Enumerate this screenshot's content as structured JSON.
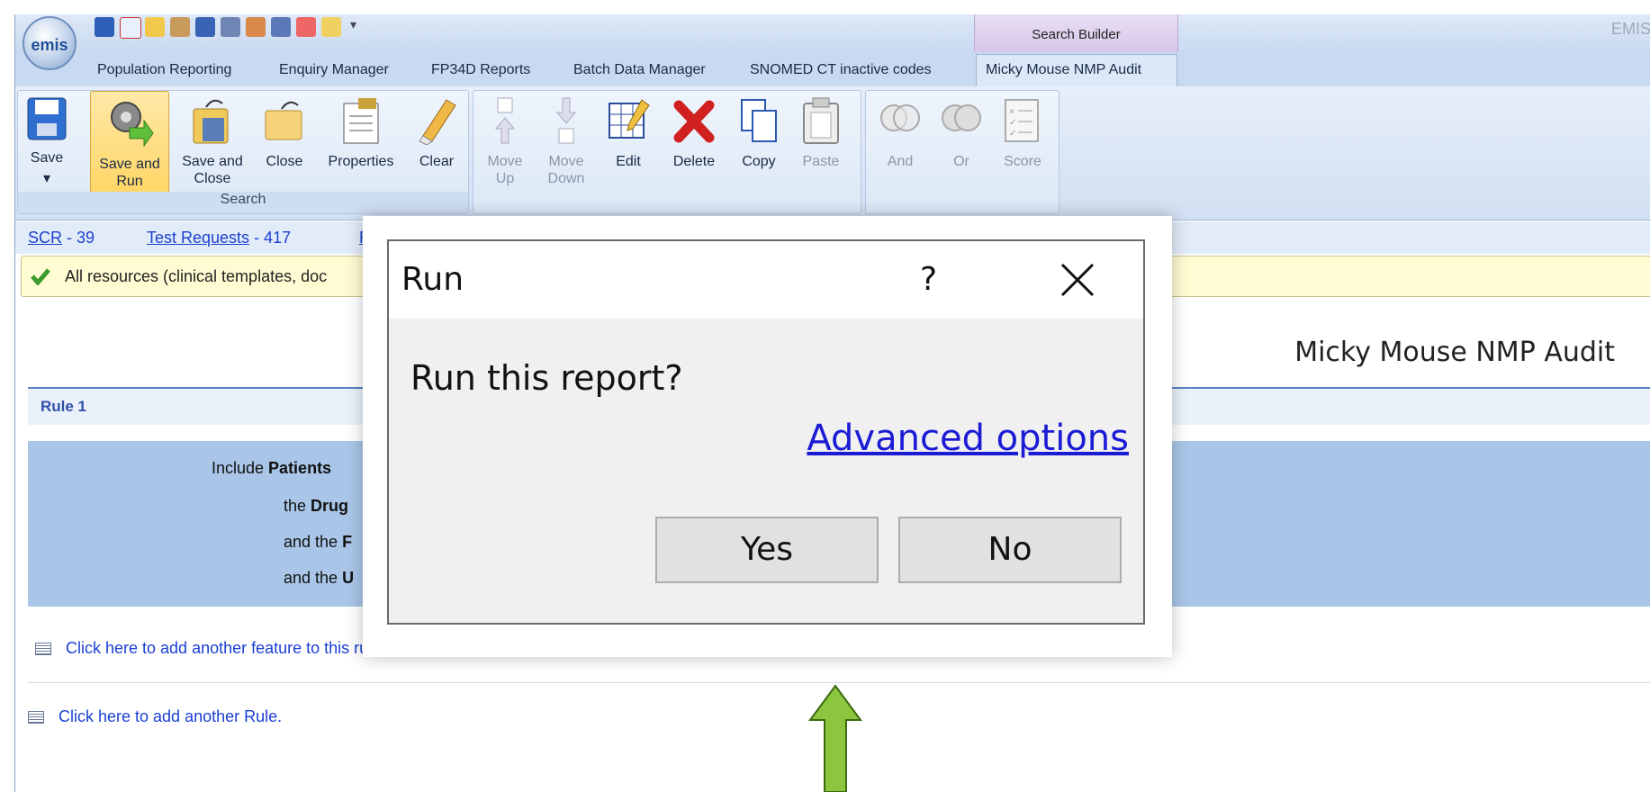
{
  "quick_access": {
    "context_tab": "Search Builder",
    "brand": "EMIS",
    "logo": "emis",
    "icons": [
      "back-icon",
      "home-icon",
      "pencil-icon",
      "users-icon",
      "notes-icon",
      "calendar-icon",
      "people-icon",
      "document-icon",
      "pen-icon",
      "mail-icon"
    ]
  },
  "tabs": [
    {
      "label": "Population Reporting"
    },
    {
      "label": "Enquiry Manager"
    },
    {
      "label": "FP34D Reports"
    },
    {
      "label": "Batch Data Manager"
    },
    {
      "label": "SNOMED CT inactive codes"
    },
    {
      "label": "Micky Mouse NMP Audit",
      "active": true
    }
  ],
  "ribbon": {
    "search_group": {
      "label": "Search",
      "buttons": [
        {
          "label": "Save",
          "icon": "floppy-icon"
        },
        {
          "label": "Save and Run",
          "icon": "gear-run-icon"
        },
        {
          "label": "Save and Close",
          "icon": "save-close-icon"
        },
        {
          "label": "Close",
          "icon": "folder-close-icon"
        },
        {
          "label": "Properties",
          "icon": "properties-icon"
        },
        {
          "label": "Clear",
          "icon": "eraser-icon"
        }
      ]
    },
    "edit_group": {
      "buttons": [
        {
          "label": "Move Up",
          "icon": "move-up-icon"
        },
        {
          "label": "Move Down",
          "icon": "move-down-icon"
        },
        {
          "label": "Edit",
          "icon": "edit-icon"
        },
        {
          "label": "Delete",
          "icon": "delete-icon"
        },
        {
          "label": "Copy",
          "icon": "copy-icon"
        },
        {
          "label": "Paste",
          "icon": "paste-icon"
        }
      ]
    },
    "logic_group": {
      "buttons": [
        {
          "label": "And",
          "icon": "and-icon"
        },
        {
          "label": "Or",
          "icon": "or-icon"
        },
        {
          "label": "Score",
          "icon": "score-icon"
        }
      ]
    }
  },
  "links_bar": {
    "scr_label": "SCR",
    "scr_count": " - 39",
    "test_label": "Test Requests",
    "test_count": " - 417",
    "third": "F"
  },
  "banner": {
    "text": "All resources (clinical templates, doc"
  },
  "content": {
    "report_title": "Micky Mouse NMP Audit",
    "rule_title": "Rule 1",
    "rule_lines": {
      "l1_pre": "Include ",
      "l1_bold": "Patients",
      "l2_pre": "the ",
      "l2_bold": "Drug",
      "l3_pre": "and the ",
      "l3_bold": "F",
      "l4_pre": "and the ",
      "l4_bold": "U"
    },
    "add_feature": "Click here to add another feature to this rule.",
    "add_rule": "Click here to add another Rule."
  },
  "dialog": {
    "title": "Run",
    "help": "?",
    "message": "Run this report?",
    "advanced": "Advanced options",
    "yes": "Yes",
    "no": "No"
  },
  "colors": {
    "ribbon": "#d2e0f3",
    "rule_box": "#a9c6e8",
    "banner": "#fffbd2",
    "link": "#1b3fd1",
    "arrow": "#8cc63f"
  }
}
